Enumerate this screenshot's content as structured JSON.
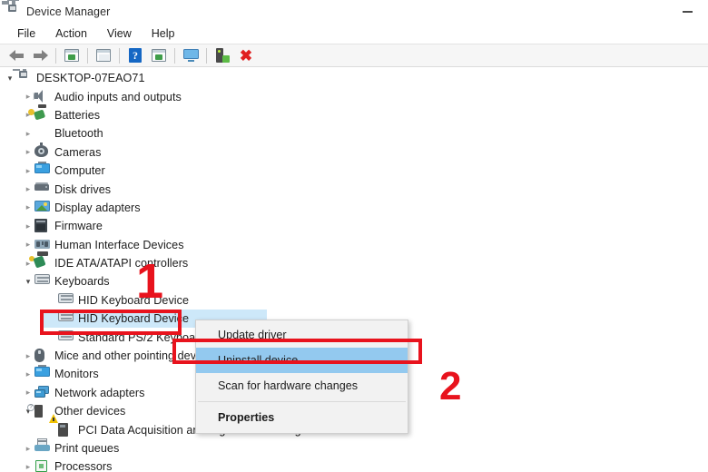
{
  "window": {
    "title": "Device Manager",
    "title_icon": "device-manager-icon",
    "minimize_label": "Minimize"
  },
  "menubar": {
    "items": [
      {
        "label": "File"
      },
      {
        "label": "Action"
      },
      {
        "label": "View"
      },
      {
        "label": "Help"
      }
    ]
  },
  "toolbar": {
    "buttons": [
      {
        "name": "back-arrow-icon",
        "tip": "Back"
      },
      {
        "name": "forward-arrow-icon",
        "tip": "Forward"
      },
      {
        "name": "show-hide-console-tree-icon",
        "tip": "Show/Hide Console Tree"
      },
      {
        "name": "properties-icon",
        "tip": "Properties"
      },
      {
        "name": "help-icon",
        "tip": "Help",
        "glyph": "?"
      },
      {
        "name": "update-driver-icon",
        "tip": "Update Driver Software"
      },
      {
        "name": "scan-monitor-icon",
        "tip": "Scan for hardware changes"
      },
      {
        "name": "enable-device-icon",
        "tip": "Enable device"
      },
      {
        "name": "uninstall-device-icon",
        "tip": "Uninstall device",
        "glyph": "✖"
      }
    ]
  },
  "tree": {
    "root": {
      "label": "DESKTOP-07EAO71",
      "icon": "computer-root-icon",
      "expanded": true
    },
    "items": [
      {
        "label": "Audio inputs and outputs",
        "icon": "speaker-icon",
        "indent": 1,
        "expanded": false
      },
      {
        "label": "Batteries",
        "icon": "battery-icon",
        "indent": 1,
        "expanded": false
      },
      {
        "label": "Bluetooth",
        "icon": "bluetooth-icon",
        "indent": 1,
        "expanded": false
      },
      {
        "label": "Cameras",
        "icon": "camera-icon",
        "indent": 1,
        "expanded": false
      },
      {
        "label": "Computer",
        "icon": "monitor-icon",
        "indent": 1,
        "expanded": false
      },
      {
        "label": "Disk drives",
        "icon": "disk-drive-icon",
        "indent": 1,
        "expanded": false
      },
      {
        "label": "Display adapters",
        "icon": "display-adapter-icon",
        "indent": 1,
        "expanded": false
      },
      {
        "label": "Firmware",
        "icon": "firmware-icon",
        "indent": 1,
        "expanded": false
      },
      {
        "label": "Human Interface Devices",
        "icon": "hid-icon",
        "indent": 1,
        "expanded": false
      },
      {
        "label": "IDE ATA/ATAPI controllers",
        "icon": "ide-controller-icon",
        "indent": 1,
        "expanded": false
      },
      {
        "label": "Keyboards",
        "icon": "keyboard-icon",
        "indent": 1,
        "expanded": true
      },
      {
        "label": "HID Keyboard Device",
        "icon": "keyboard-icon",
        "indent": 2,
        "leaf": true
      },
      {
        "label": "HID Keyboard Device",
        "icon": "keyboard-icon",
        "indent": 2,
        "leaf": true,
        "selected": true
      },
      {
        "label": "Standard PS/2 Keyboard",
        "icon": "keyboard-icon",
        "indent": 2,
        "leaf": true
      },
      {
        "label": "Mice and other pointing devices",
        "icon": "mouse-icon",
        "indent": 1,
        "expanded": false
      },
      {
        "label": "Monitors",
        "icon": "monitor-icon",
        "indent": 1,
        "expanded": false
      },
      {
        "label": "Network adapters",
        "icon": "network-adapter-icon",
        "indent": 1,
        "expanded": false
      },
      {
        "label": "Other devices",
        "icon": "other-device-icon",
        "indent": 1,
        "expanded": true
      },
      {
        "label": "PCI Data Acquisition and Signal Processing Controller",
        "icon": "warning-device-icon",
        "indent": 2,
        "leaf": true
      },
      {
        "label": "Print queues",
        "icon": "print-queue-icon",
        "indent": 1,
        "expanded": false
      },
      {
        "label": "Processors",
        "icon": "processor-icon",
        "indent": 1,
        "expanded": false
      }
    ]
  },
  "context_menu": {
    "items": [
      {
        "label": "Update driver",
        "highlighted": false,
        "bold": false
      },
      {
        "label": "Uninstall device",
        "highlighted": true,
        "bold": false
      },
      {
        "label": "Scan for hardware changes",
        "highlighted": false,
        "bold": false
      },
      {
        "label": "Properties",
        "highlighted": false,
        "bold": true
      }
    ]
  },
  "annotations": {
    "color": "#e8131d",
    "step1": {
      "number": "1"
    },
    "step2": {
      "number": "2"
    }
  }
}
